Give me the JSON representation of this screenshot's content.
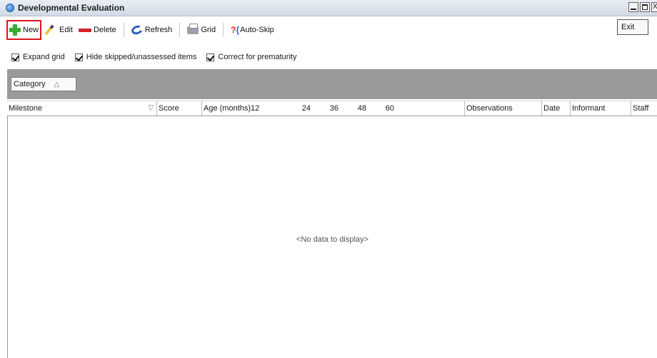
{
  "window": {
    "title": "Developmental Evaluation",
    "controls": {
      "close_glyph": "X"
    }
  },
  "toolbar": {
    "new_label": "New",
    "edit_label": "Edit",
    "delete_label": "Delete",
    "refresh_label": "Refresh",
    "grid_label": "Grid",
    "autoskip_label": "Auto-Skip",
    "exit_label": "Exit"
  },
  "options": {
    "expand_grid": {
      "label": "Expand grid",
      "checked": true
    },
    "hide_skipped": {
      "label": "Hide skipped/unassessed items",
      "checked": true
    },
    "correct_prematurity": {
      "label": "Correct for prematurity",
      "checked": true
    }
  },
  "group_panel": {
    "chip_label": "Category"
  },
  "grid": {
    "columns": {
      "milestone": "Milestone",
      "score": "Score",
      "age": "Age (months)",
      "age_ticks": [
        "12",
        "24",
        "36",
        "48",
        "60"
      ],
      "observations": "Observations",
      "date": "Date",
      "informant": "Informant",
      "staff": "Staff"
    },
    "rows": [],
    "empty_text": "<No data to display>"
  },
  "colors": {
    "highlight_outline": "#e0141b",
    "group_panel_bg": "#9a9a9a",
    "new_icon": "#3aaa35",
    "delete_icon": "#d4232b",
    "refresh_icon": "#2a5fc7"
  },
  "icons": {
    "app": "app-icon",
    "new": "plus-icon",
    "edit": "pencil-icon",
    "delete": "minus-icon",
    "refresh": "refresh-icon",
    "grid": "printer-icon",
    "autoskip": "question-bracket-icon",
    "sort": "sort-ascending-icon",
    "filter": "filter-icon"
  }
}
